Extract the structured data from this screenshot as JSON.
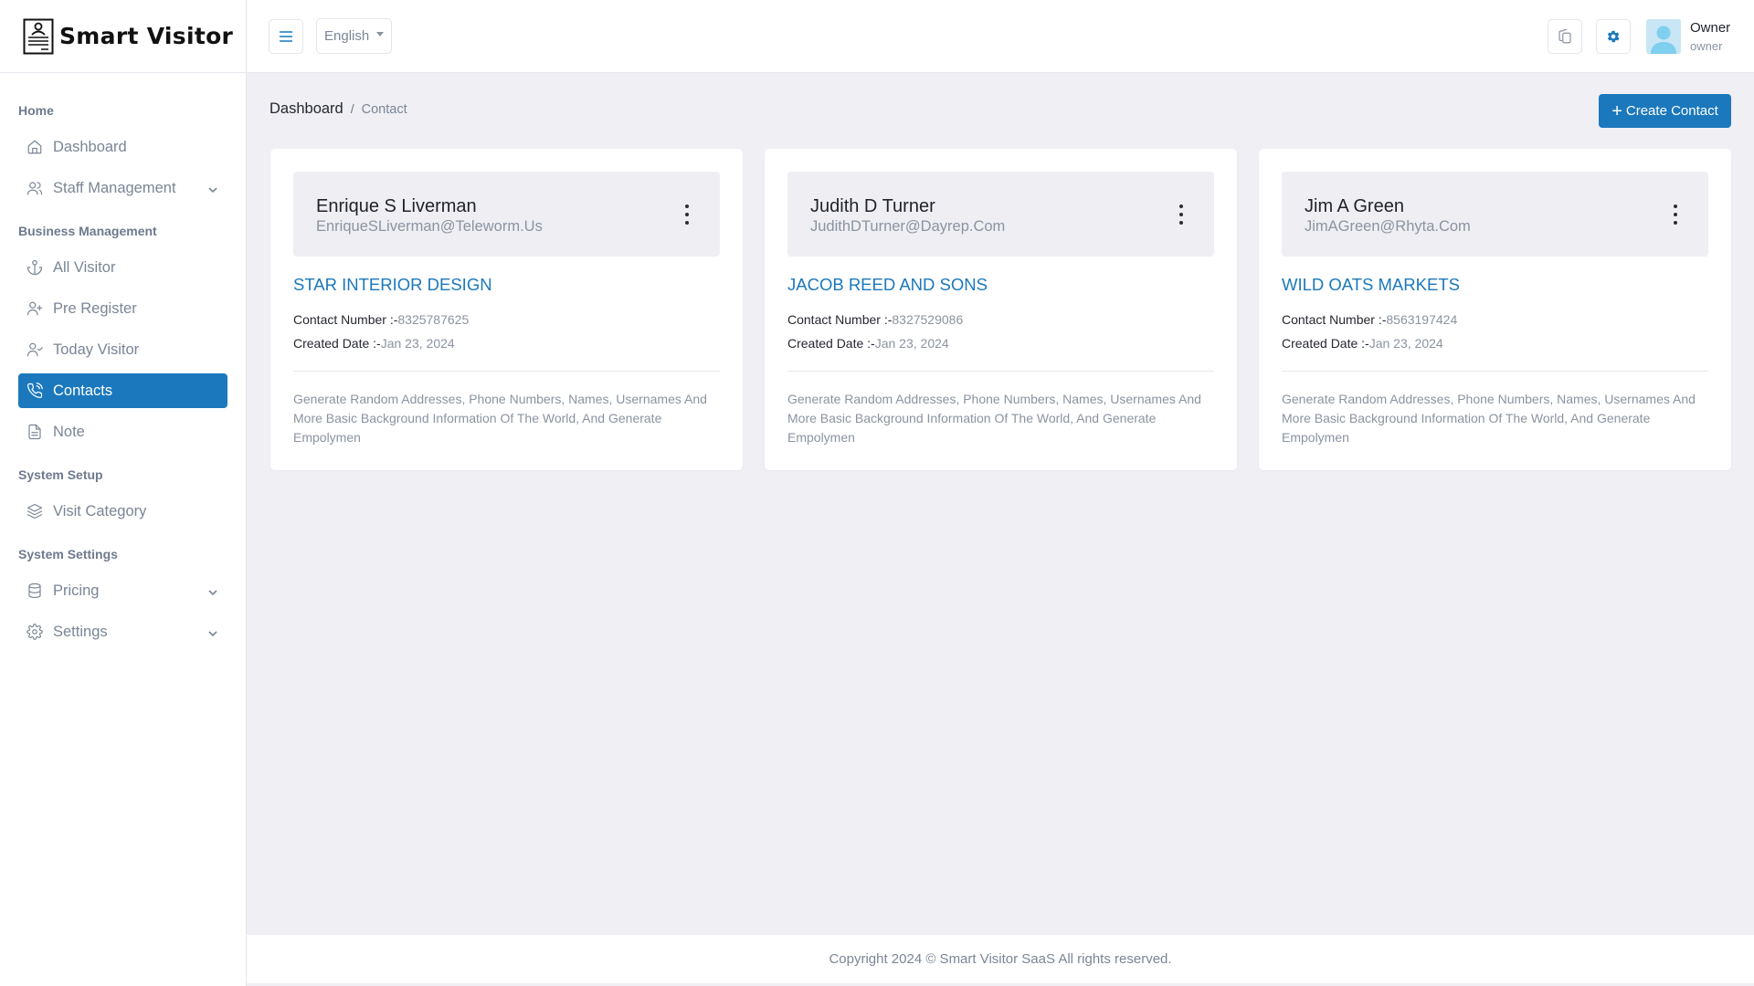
{
  "app": {
    "name": "Smart Visitor"
  },
  "sidebar": {
    "sections": [
      {
        "heading": "Home"
      },
      {
        "heading": "Business Management"
      },
      {
        "heading": "System Setup"
      },
      {
        "heading": "System Settings"
      }
    ],
    "items": [
      {
        "label": "Dashboard",
        "icon": "home-icon"
      },
      {
        "label": "Staff Management",
        "icon": "users-icon",
        "expandable": true
      },
      {
        "label": "All Visitor",
        "icon": "anchor-icon"
      },
      {
        "label": "Pre Register",
        "icon": "user-plus-icon"
      },
      {
        "label": "Today Visitor",
        "icon": "user-check-icon"
      },
      {
        "label": "Contacts",
        "icon": "phone-call-icon",
        "active": true
      },
      {
        "label": "Note",
        "icon": "file-text-icon"
      },
      {
        "label": "Visit Category",
        "icon": "layers-icon"
      },
      {
        "label": "Pricing",
        "icon": "database-icon",
        "expandable": true
      },
      {
        "label": "Settings",
        "icon": "settings-icon",
        "expandable": true
      }
    ]
  },
  "topbar": {
    "language": "English",
    "user": {
      "name": "Owner",
      "role": "owner"
    }
  },
  "breadcrumb": {
    "home": "Dashboard",
    "separator": "/",
    "current": "Contact"
  },
  "actions": {
    "create_contact": "Create Contact"
  },
  "labels": {
    "contact_number": "Contact Number :-",
    "created_date": "Created Date :-"
  },
  "contacts": [
    {
      "name": "Enrique S Liverman",
      "email": "EnriqueSLiverman@Teleworm.Us",
      "company": "STAR INTERIOR DESIGN",
      "phone": "8325787625",
      "created": "Jan 23, 2024",
      "description": "Generate Random Addresses, Phone Numbers, Names, Usernames And More Basic Background Information Of The World, And Generate Empolymen"
    },
    {
      "name": "Judith D Turner",
      "email": "JudithDTurner@Dayrep.Com",
      "company": "JACOB REED AND SONS",
      "phone": "8327529086",
      "created": "Jan 23, 2024",
      "description": "Generate Random Addresses, Phone Numbers, Names, Usernames And More Basic Background Information Of The World, And Generate Empolymen"
    },
    {
      "name": "Jim A Green",
      "email": "JimAGreen@Rhyta.Com",
      "company": "WILD OATS MARKETS",
      "phone": "8563197424",
      "created": "Jan 23, 2024",
      "description": "Generate Random Addresses, Phone Numbers, Names, Usernames And More Basic Background Information Of The World, And Generate Empolymen"
    }
  ],
  "footer": {
    "text": "Copyright 2024 © Smart Visitor SaaS All rights reserved."
  },
  "colors": {
    "primary": "#1b78bd",
    "background": "#efeff4",
    "muted_text": "#8b93a1"
  }
}
